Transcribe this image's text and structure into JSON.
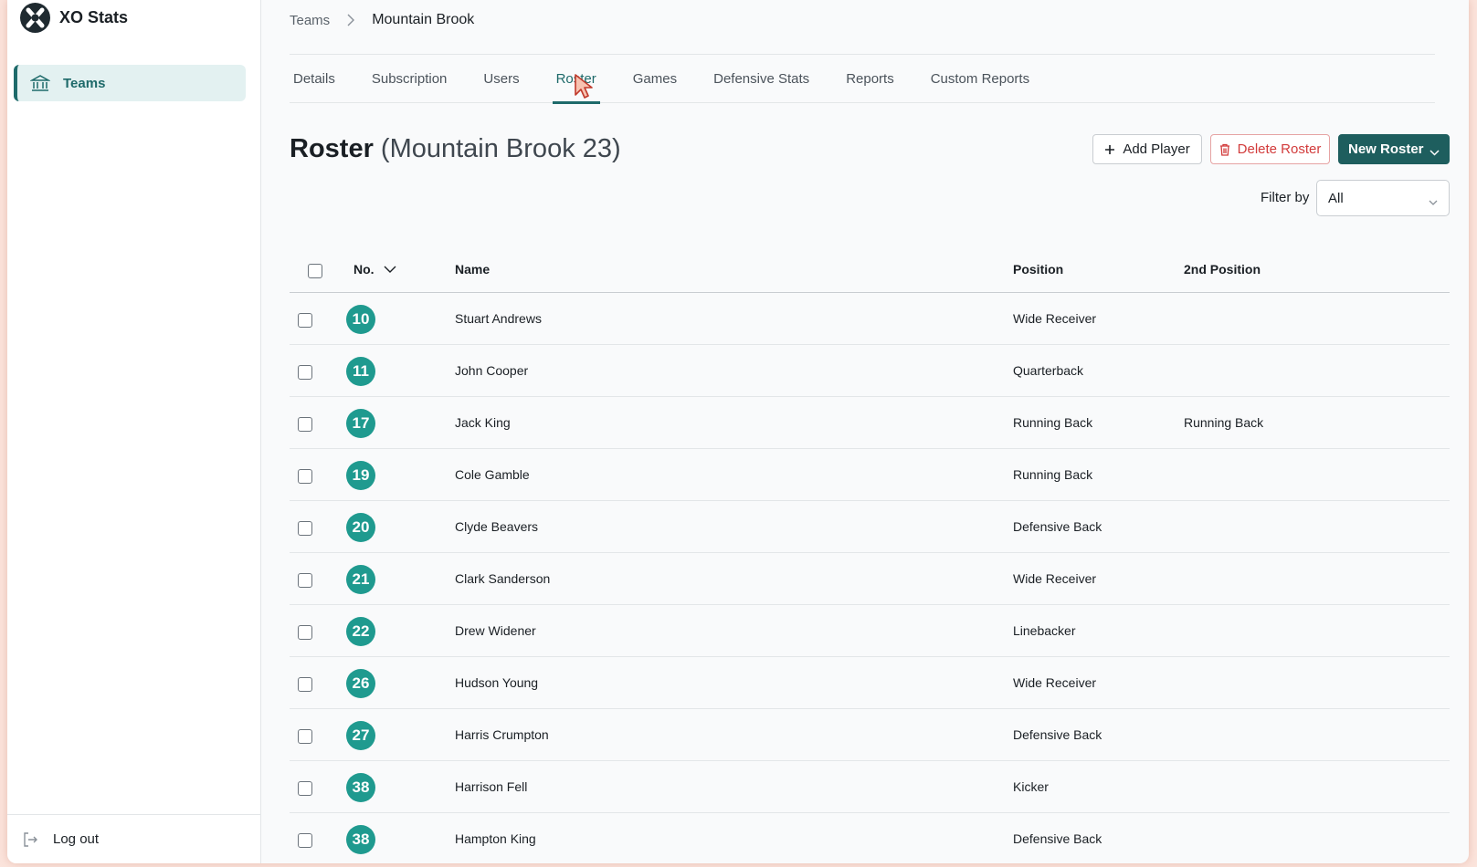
{
  "app": {
    "name": "XO Stats"
  },
  "sidebar": {
    "items": [
      {
        "label": "Teams",
        "icon": "bank-icon"
      }
    ],
    "logout_label": "Log out"
  },
  "breadcrumb": {
    "parent": "Teams",
    "current": "Mountain Brook"
  },
  "tabs": [
    {
      "label": "Details"
    },
    {
      "label": "Subscription"
    },
    {
      "label": "Users"
    },
    {
      "label": "Roster",
      "active": true
    },
    {
      "label": "Games"
    },
    {
      "label": "Defensive Stats"
    },
    {
      "label": "Reports"
    },
    {
      "label": "Custom Reports"
    }
  ],
  "page": {
    "title": "Roster",
    "subtitle": "(Mountain Brook 23)"
  },
  "actions": {
    "add_player": "Add Player",
    "delete_roster": "Delete Roster",
    "new_roster": "New Roster"
  },
  "filter": {
    "label": "Filter by",
    "value": "All"
  },
  "table": {
    "headers": {
      "no": "No.",
      "name": "Name",
      "position": "Position",
      "position2": "2nd Position"
    },
    "rows": [
      {
        "no": "10",
        "name": "Stuart Andrews",
        "position": "Wide Receiver",
        "position2": ""
      },
      {
        "no": "11",
        "name": "John Cooper",
        "position": "Quarterback",
        "position2": ""
      },
      {
        "no": "17",
        "name": "Jack King",
        "position": "Running Back",
        "position2": "Running Back"
      },
      {
        "no": "19",
        "name": "Cole Gamble",
        "position": "Running Back",
        "position2": ""
      },
      {
        "no": "20",
        "name": "Clyde Beavers",
        "position": "Defensive Back",
        "position2": ""
      },
      {
        "no": "21",
        "name": "Clark Sanderson",
        "position": "Wide Receiver",
        "position2": ""
      },
      {
        "no": "22",
        "name": "Drew Widener",
        "position": "Linebacker",
        "position2": ""
      },
      {
        "no": "26",
        "name": "Hudson Young",
        "position": "Wide Receiver",
        "position2": ""
      },
      {
        "no": "27",
        "name": "Harris Crumpton",
        "position": "Defensive Back",
        "position2": ""
      },
      {
        "no": "38",
        "name": "Harrison Fell",
        "position": "Kicker",
        "position2": ""
      },
      {
        "no": "38",
        "name": "Hampton King",
        "position": "Defensive Back",
        "position2": ""
      }
    ]
  },
  "colors": {
    "accent": "#1e6a6a",
    "badge": "#1f9a8f",
    "danger": "#d23b3b",
    "primary_button": "#1e5e5e"
  }
}
